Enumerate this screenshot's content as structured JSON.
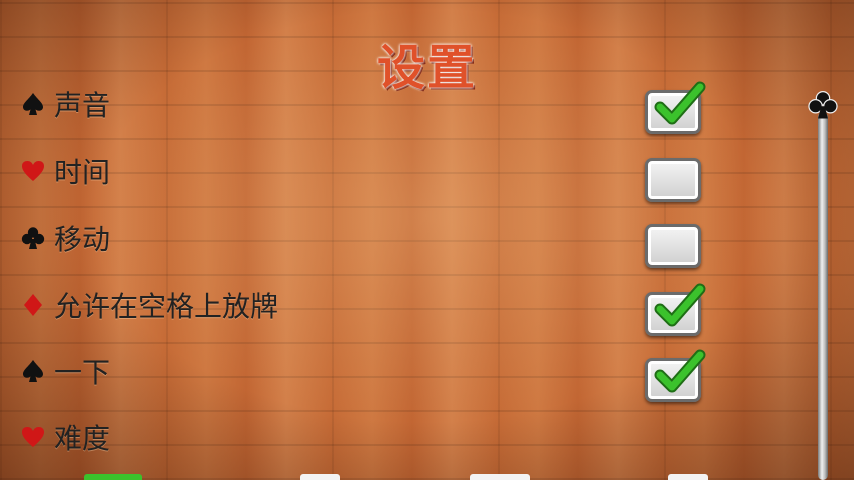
{
  "title": "设置",
  "options": [
    {
      "label": "声音",
      "suit": "spade-icon",
      "checked": true
    },
    {
      "label": "时间",
      "suit": "heart-icon",
      "checked": false
    },
    {
      "label": "移动",
      "suit": "club-icon",
      "checked": false
    },
    {
      "label": "允许在空格上放牌",
      "suit": "diamond-icon",
      "checked": true
    },
    {
      "label": "一下",
      "suit": "spade-icon",
      "checked": true
    },
    {
      "label": "难度",
      "suit": "heart-icon",
      "checked": null
    }
  ],
  "colors": {
    "title": "#e0512a",
    "check": "#39b72d",
    "red_suit": "#d01717",
    "black_suit": "#111111"
  },
  "scrollbar": {
    "thumb_icon": "club-icon"
  }
}
